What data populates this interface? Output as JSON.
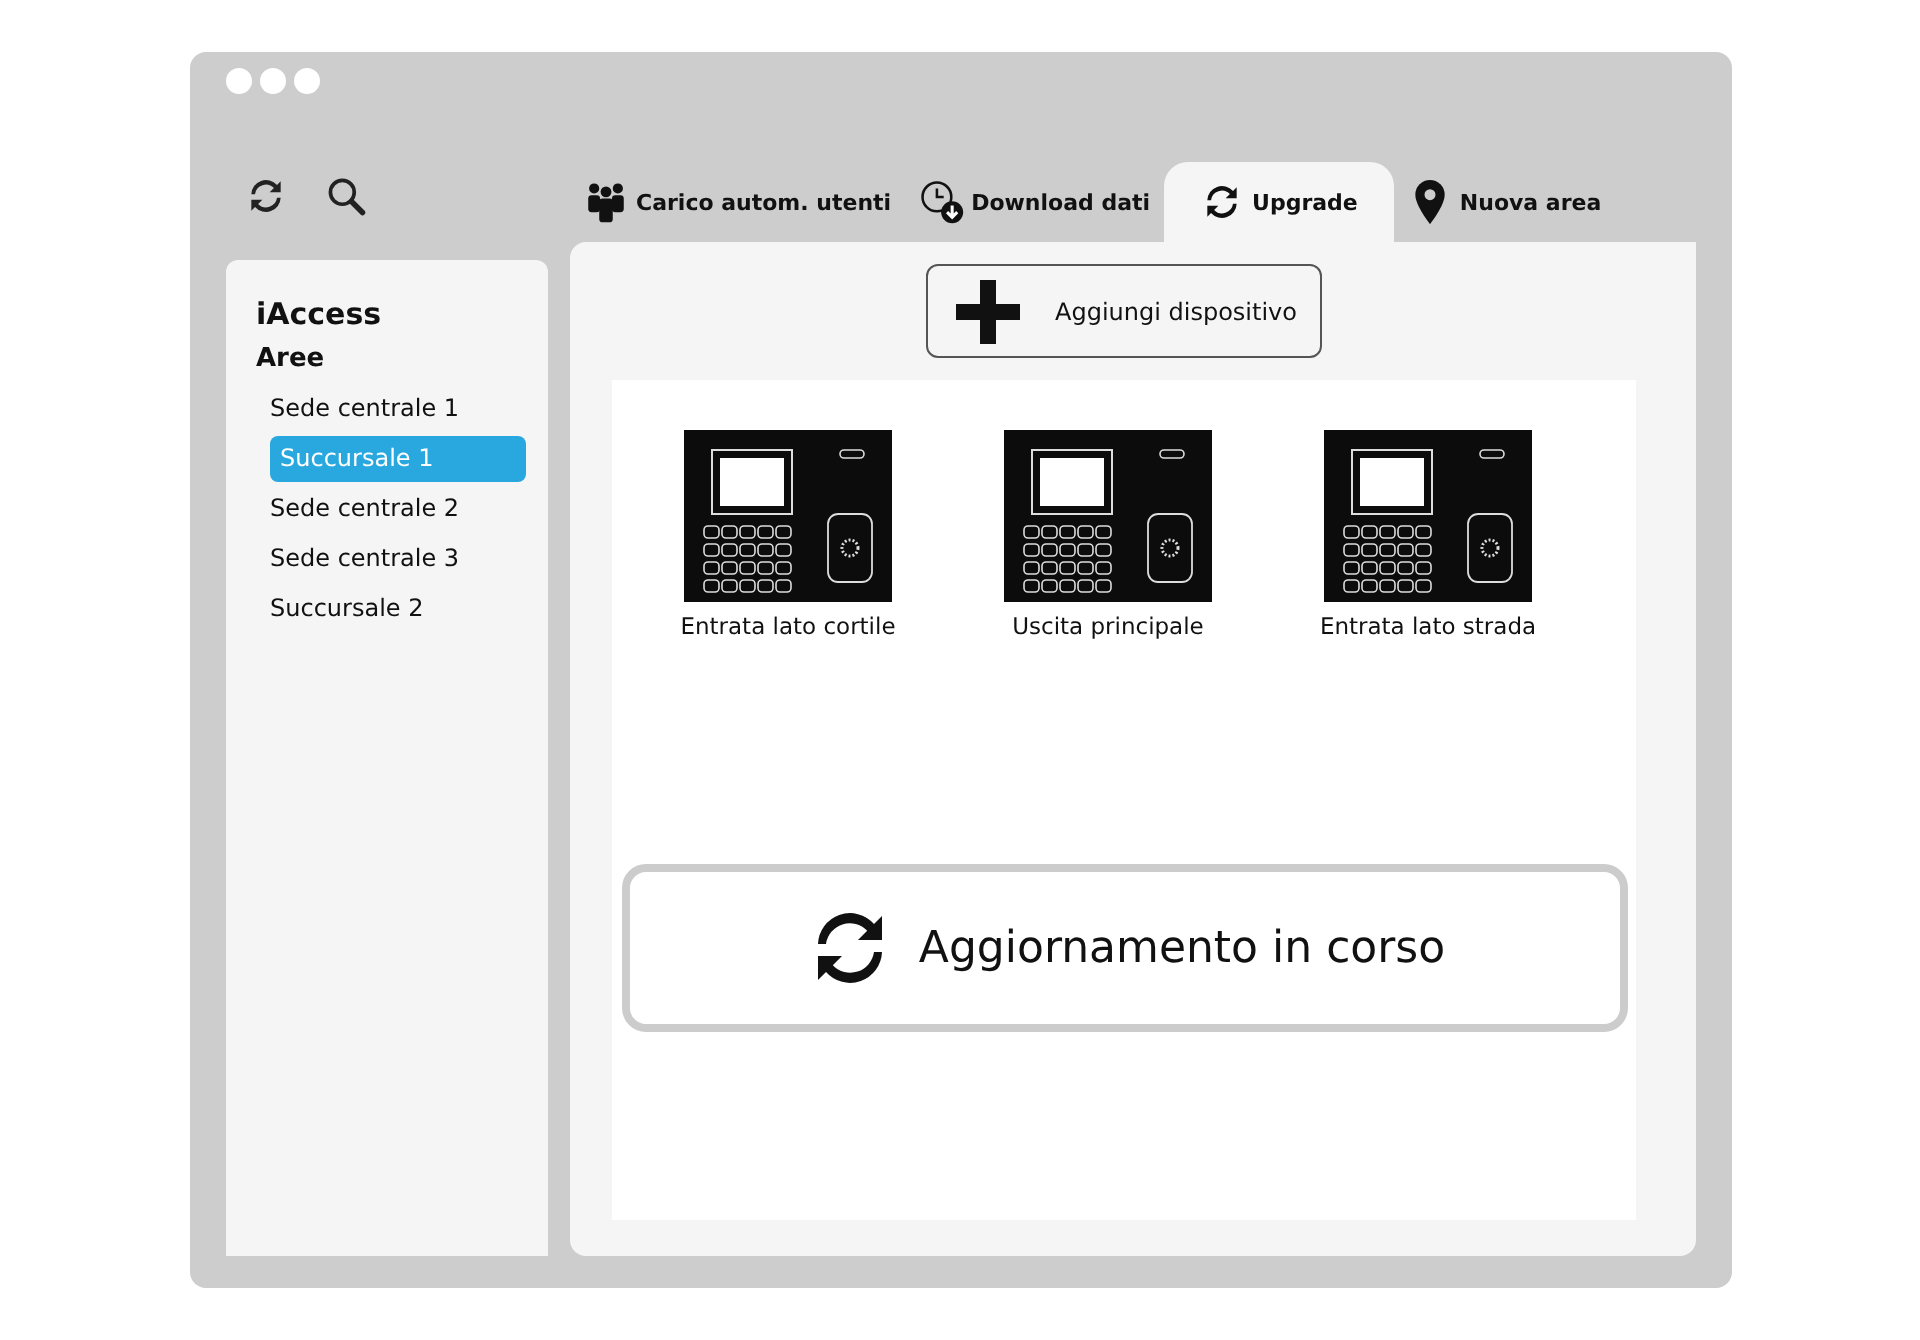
{
  "tabs": [
    {
      "label": "Carico autom. utenti",
      "kind": "users",
      "selected": false
    },
    {
      "label": "Download dati",
      "kind": "clock",
      "selected": false
    },
    {
      "label": "Upgrade",
      "kind": "refresh",
      "selected": true
    },
    {
      "label": "Nuova area",
      "kind": "pin",
      "selected": false
    }
  ],
  "sidebar": {
    "title": "iAccess",
    "section": "Aree",
    "items": [
      {
        "label": "Sede centrale 1",
        "selected": false
      },
      {
        "label": "Succursale 1",
        "selected": true
      },
      {
        "label": "Sede centrale 2",
        "selected": false
      },
      {
        "label": "Sede centrale 3",
        "selected": false
      },
      {
        "label": "Succursale 2",
        "selected": false
      }
    ]
  },
  "add_button": "Aggiungi dispositivo",
  "devices": [
    {
      "name": "Entrata lato cortile"
    },
    {
      "name": "Uscita principale"
    },
    {
      "name": "Entrata lato strada"
    }
  ],
  "status": "Aggiornamento in corso"
}
